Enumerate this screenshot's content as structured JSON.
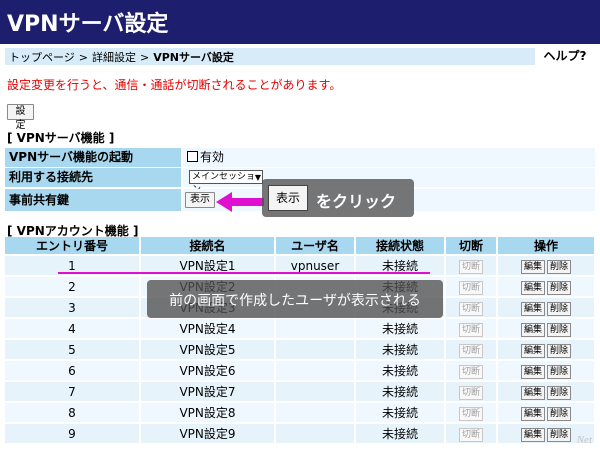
{
  "page_title": "VPNサーバ設定",
  "breadcrumb": {
    "items": [
      "トップページ",
      "詳細設定",
      "VPNサーバ設定"
    ],
    "sep": ">"
  },
  "help_label": "ヘルプ?",
  "warning": "設定変更を行うと、通信・通話が切断されることがあります。",
  "settei_button": "設定",
  "server_section": {
    "title": "[ VPNサーバ機能 ]",
    "rows": {
      "start_label": "VPNサーバ機能の起動",
      "start_value": "有効",
      "conn_label": "利用する接続先",
      "conn_value": "メインセッション",
      "psk_label": "事前共有鍵",
      "psk_button": "表示"
    }
  },
  "account_section": {
    "title": "[ VPNアカウント機能 ]",
    "headers": [
      "エントリ番号",
      "接続名",
      "ユーザ名",
      "接続状態",
      "切断",
      "操作"
    ],
    "disconnect_label": "切断",
    "edit_label": "編集",
    "delete_label": "削除",
    "rows": [
      {
        "no": "1",
        "name": "VPN設定1",
        "user": "vpnuser",
        "status": "未接続"
      },
      {
        "no": "2",
        "name": "VPN設定2",
        "user": "",
        "status": "未接続"
      },
      {
        "no": "3",
        "name": "VPN設定3",
        "user": "",
        "status": "未接続"
      },
      {
        "no": "4",
        "name": "VPN設定4",
        "user": "",
        "status": "未接続"
      },
      {
        "no": "5",
        "name": "VPN設定5",
        "user": "",
        "status": "未接続"
      },
      {
        "no": "6",
        "name": "VPN設定6",
        "user": "",
        "status": "未接続"
      },
      {
        "no": "7",
        "name": "VPN設定7",
        "user": "",
        "status": "未接続"
      },
      {
        "no": "8",
        "name": "VPN設定8",
        "user": "",
        "status": "未接続"
      },
      {
        "no": "9",
        "name": "VPN設定9",
        "user": "",
        "status": "未接続"
      }
    ]
  },
  "annotations": {
    "click_button": "表示",
    "click_text": "をクリック",
    "user_note": "前の画面で作成したユーザが表示される",
    "arrow_color": "#e010d0"
  },
  "watermark": "Net"
}
